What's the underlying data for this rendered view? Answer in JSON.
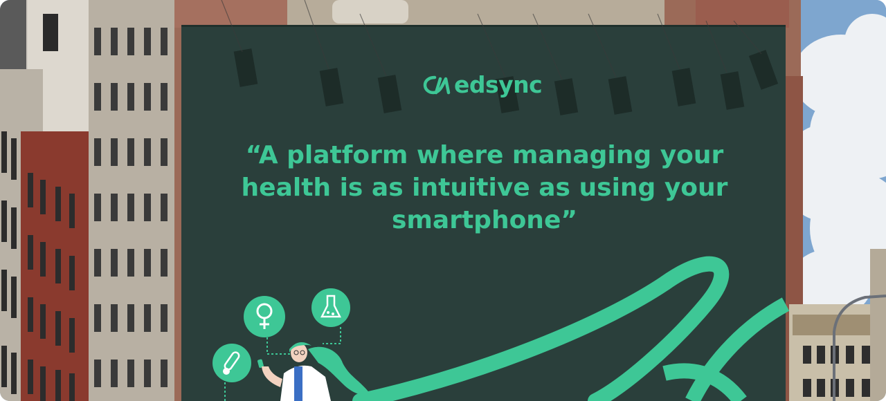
{
  "billboard": {
    "brand": "edsync",
    "quote": "“A platform where managing your health is as intuitive as using your smartphone”"
  },
  "illustration": {
    "icons": [
      "thermometer-icon",
      "female-symbol-icon",
      "flask-icon"
    ]
  },
  "colors": {
    "billboard_bg": "#2a3f3b",
    "accent_green": "#3ec796",
    "sky": "#7aa0c8"
  }
}
